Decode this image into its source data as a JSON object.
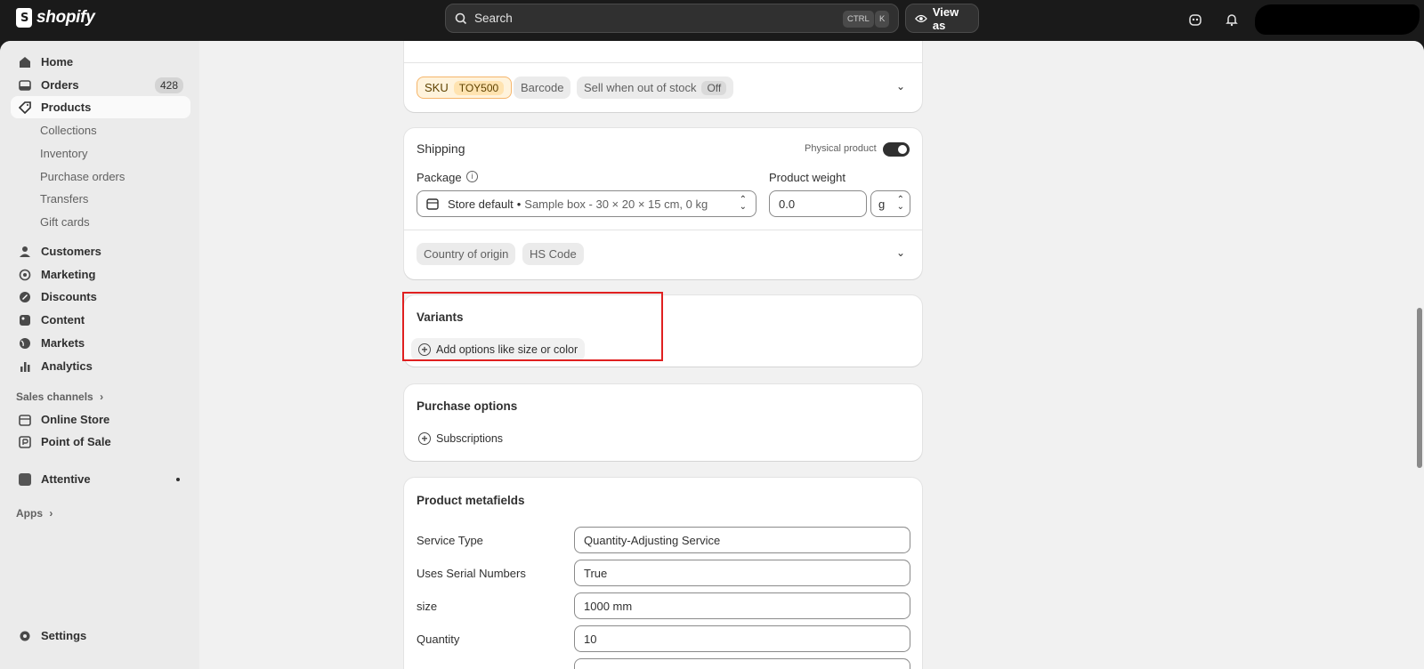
{
  "topbar": {
    "logo_text": "shopify",
    "search_placeholder": "Search",
    "kbd_ctrl": "CTRL",
    "kbd_k": "K",
    "view_as": "View as"
  },
  "sidebar": {
    "items": [
      {
        "label": "Home",
        "icon": "home-icon"
      },
      {
        "label": "Orders",
        "icon": "orders-icon",
        "badge": "428"
      },
      {
        "label": "Products",
        "icon": "tag-icon",
        "active": true
      }
    ],
    "product_subitems": [
      "Collections",
      "Inventory",
      "Purchase orders",
      "Transfers",
      "Gift cards"
    ],
    "items2": [
      {
        "label": "Customers",
        "icon": "person-icon"
      },
      {
        "label": "Marketing",
        "icon": "target-icon"
      },
      {
        "label": "Discounts",
        "icon": "discount-icon"
      },
      {
        "label": "Content",
        "icon": "content-icon"
      },
      {
        "label": "Markets",
        "icon": "globe-icon"
      },
      {
        "label": "Analytics",
        "icon": "bar-chart-icon"
      }
    ],
    "sales_channels_label": "Sales channels",
    "channels": [
      {
        "label": "Online Store",
        "icon": "store-icon"
      },
      {
        "label": "Point of Sale",
        "icon": "pos-icon"
      }
    ],
    "app_item": {
      "label": "Attentive",
      "icon": "app-icon"
    },
    "apps_label": "Apps",
    "settings": "Settings"
  },
  "inventory_card": {
    "sku_label": "SKU",
    "sku_value": "TOY500",
    "barcode": "Barcode",
    "sell_oos": "Sell when out of stock",
    "sell_oos_value": "Off"
  },
  "shipping_card": {
    "title": "Shipping",
    "physical_product": "Physical product",
    "package_label": "Package",
    "package_name": "Store default",
    "package_detail": "Sample box - 30 × 20 × 15 cm, 0 kg",
    "weight_label": "Product weight",
    "weight_value": "0.0",
    "weight_unit": "g",
    "country_of_origin": "Country of origin",
    "hs_code": "HS Code"
  },
  "variants_card": {
    "title": "Variants",
    "add_options": "Add options like size or color"
  },
  "purchase_card": {
    "title": "Purchase options",
    "subscriptions": "Subscriptions"
  },
  "metafields_card": {
    "title": "Product metafields",
    "fields": [
      {
        "label": "Service Type",
        "value": "Quantity-Adjusting Service"
      },
      {
        "label": "Uses Serial Numbers",
        "value": "True"
      },
      {
        "label": "size",
        "value": "1000 mm"
      },
      {
        "label": "Quantity",
        "value": "10"
      }
    ]
  }
}
